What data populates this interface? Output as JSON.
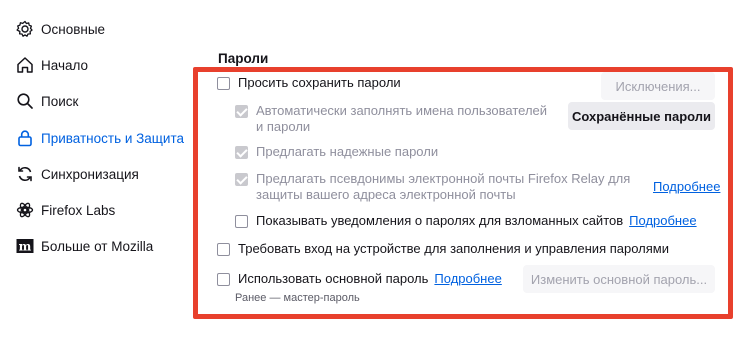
{
  "sidebar": {
    "items": [
      {
        "label": "Основные",
        "icon": "gear-icon",
        "active": false
      },
      {
        "label": "Начало",
        "icon": "home-icon",
        "active": false
      },
      {
        "label": "Поиск",
        "icon": "search-icon",
        "active": false
      },
      {
        "label": "Приватность и Защита",
        "icon": "lock-icon",
        "active": true
      },
      {
        "label": "Синхронизация",
        "icon": "sync-icon",
        "active": false
      },
      {
        "label": "Firefox Labs",
        "icon": "flask-icon",
        "active": false
      },
      {
        "label": "Больше от Mozilla",
        "icon": "mozilla-icon",
        "active": false
      }
    ]
  },
  "passwords": {
    "title": "Пароли",
    "ask_save": "Просить сохранить пароли",
    "exceptions_button": "Исключения...",
    "autofill": "Автоматически заполнять имена пользователей и пароли",
    "saved_passwords_button": "Сохранённые пароли",
    "suggest_strong": "Предлагать надежные пароли",
    "relay": "Предлагать псевдонимы электронной почты Firefox Relay для защиты вашего адреса электронной почты",
    "relay_learn_more": "Подробнее",
    "breach_alerts": "Показывать уведомления о паролях для взломанных сайтов",
    "breach_learn_more": "Подробнее",
    "require_device_auth": "Требовать вход на устройстве для заполнения и управления паролями",
    "primary_password": "Использовать основной пароль",
    "primary_learn_more": "Подробнее",
    "change_primary_button": "Изменить основной пароль...",
    "primary_note": "Ранее — мастер-пароль"
  },
  "colors": {
    "accent": "#0061e0",
    "highlight_frame": "#e8402d"
  }
}
